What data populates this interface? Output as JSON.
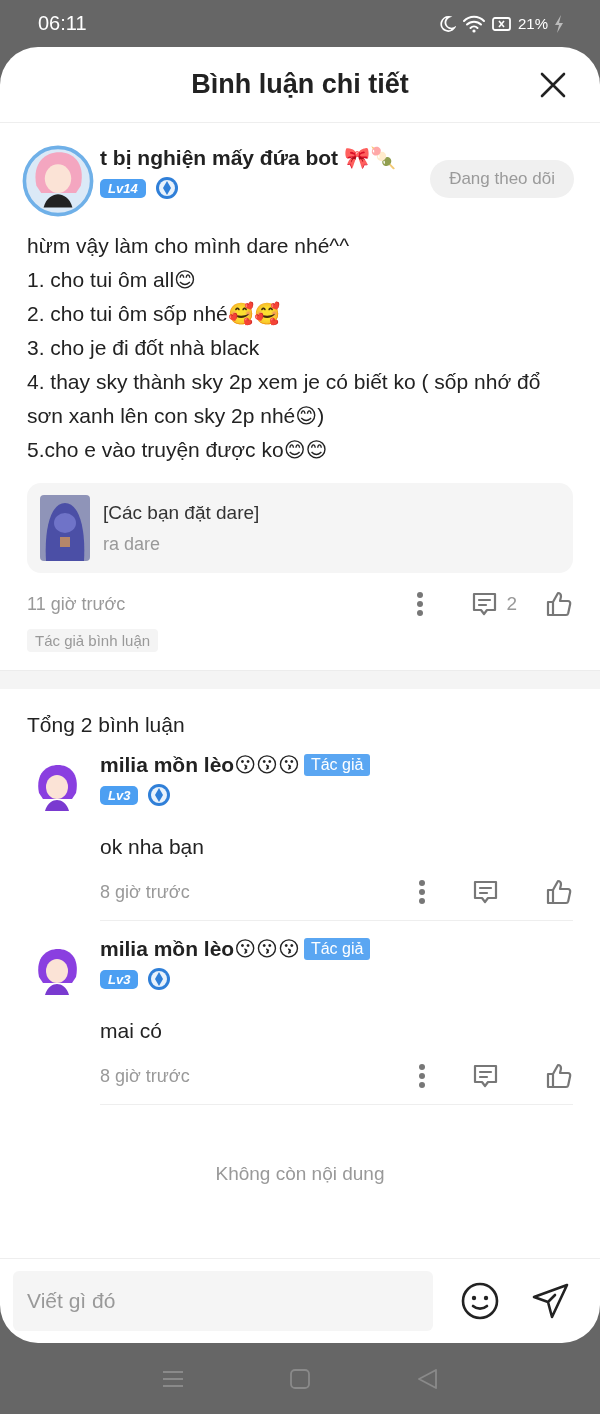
{
  "status_bar": {
    "time": "06:11",
    "battery": "21%"
  },
  "header": {
    "title": "Bình luận chi tiết"
  },
  "main_comment": {
    "author": "t bị nghiện mấy đứa bot 🎀🍡",
    "level": "Lv14",
    "follow_button": "Đang theo dõi",
    "lines": [
      "hừm vậy làm cho mình dare nhé^^",
      "1. cho tui ôm all😊",
      "2. cho tui ôm sốp nhé🥰🥰",
      "3. cho je đi đốt nhà black",
      "4. thay sky thành sky 2p xem je có biết ko ( sốp nhớ đổ sơn xanh lên con sky 2p nhé😊)",
      "5.cho e vào truyện được ko😊😊"
    ],
    "story_card": {
      "title": "[Các bạn đặt dare]",
      "subtitle": "ra dare"
    },
    "time": "11 giờ trước",
    "reply_count": "2",
    "tag": "Tác giả bình luận"
  },
  "total": "Tổng 2 bình luận",
  "replies": [
    {
      "author": "milia mồn lèo😗😗😗",
      "badge": "Tác giả",
      "level": "Lv3",
      "text": "ok nha bạn",
      "time": "8 giờ trước"
    },
    {
      "author": "milia mồn lèo😗😗😗",
      "badge": "Tác giả",
      "level": "Lv3",
      "text": "mai có",
      "time": "8 giờ trước"
    }
  ],
  "end_note": "Không còn nội dung",
  "composer": {
    "placeholder": "Viết gì đó"
  }
}
